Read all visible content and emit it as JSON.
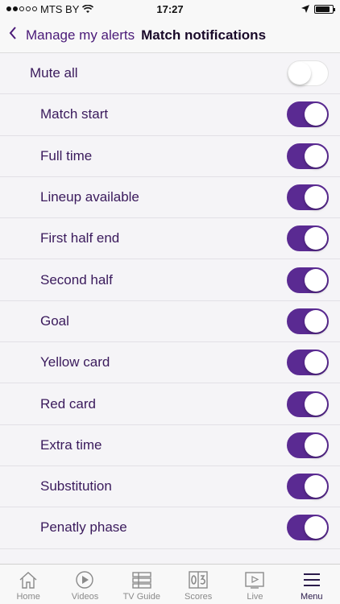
{
  "status_bar": {
    "carrier": "MTS BY",
    "time": "17:27"
  },
  "nav": {
    "back_label": "Manage my alerts",
    "title": "Match notifications"
  },
  "master": {
    "label": "Mute all",
    "on": false
  },
  "items": [
    {
      "label": "Match start",
      "on": true
    },
    {
      "label": "Full time",
      "on": true
    },
    {
      "label": "Lineup available",
      "on": true
    },
    {
      "label": "First half end",
      "on": true
    },
    {
      "label": "Second half",
      "on": true
    },
    {
      "label": "Goal",
      "on": true
    },
    {
      "label": "Yellow card",
      "on": true
    },
    {
      "label": "Red card",
      "on": true
    },
    {
      "label": "Extra time",
      "on": true
    },
    {
      "label": "Substitution",
      "on": true
    },
    {
      "label": "Penatly phase",
      "on": true
    }
  ],
  "tabs": [
    {
      "label": "Home",
      "icon": "home-icon",
      "active": false
    },
    {
      "label": "Videos",
      "icon": "play-circle-icon",
      "active": false
    },
    {
      "label": "TV Guide",
      "icon": "tv-guide-icon",
      "active": false
    },
    {
      "label": "Scores",
      "icon": "scoreboard-icon",
      "active": false
    },
    {
      "label": "Live",
      "icon": "live-icon",
      "active": false
    },
    {
      "label": "Menu",
      "icon": "menu-icon",
      "active": true
    }
  ],
  "colors": {
    "accent": "#5a2a92",
    "text": "#3a1a5c"
  }
}
